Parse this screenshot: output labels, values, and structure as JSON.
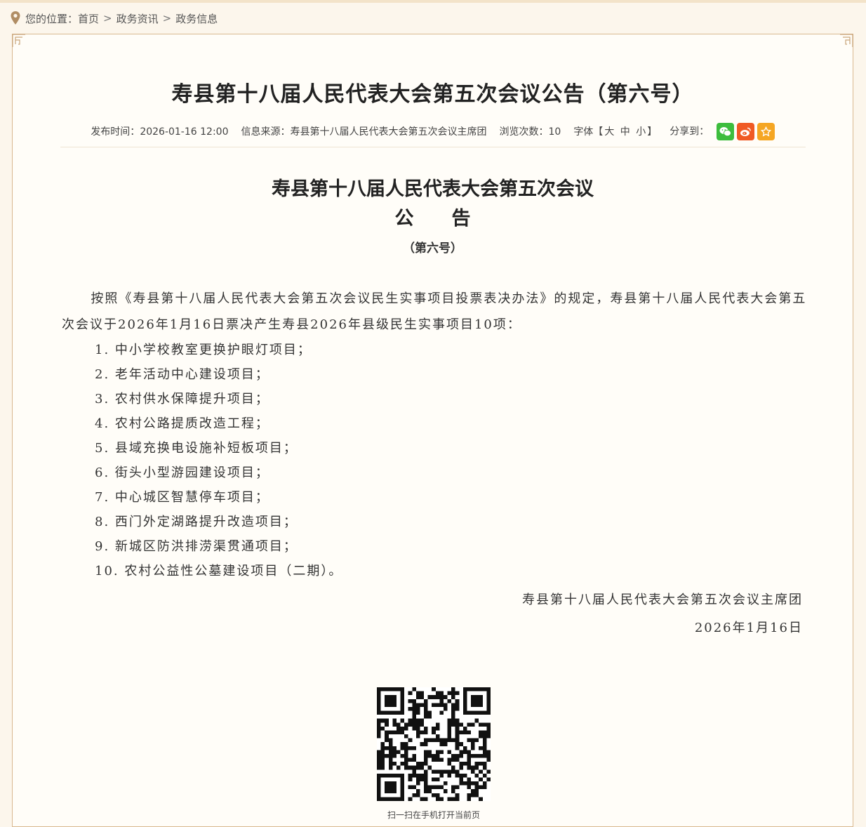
{
  "breadcrumb": {
    "prefix": "您的位置：",
    "items": [
      "首页",
      "政务资讯",
      "政务信息"
    ],
    "separator": ">"
  },
  "article": {
    "title": "寿县第十八届人民代表大会第五次会议公告（第六号）",
    "meta": {
      "publish_label": "发布时间：",
      "publish_time": "2026-01-16 12:00",
      "source_label": "信息来源：",
      "source": "寿县第十八届人民代表大会第五次会议主席团",
      "views_label": "浏览次数：",
      "views": "10",
      "font_label": "字体【",
      "font_large": "大",
      "font_medium": "中",
      "font_small": "小",
      "font_close": "】",
      "share_label": "分享到：",
      "share_icons": [
        "wechat-icon",
        "weibo-icon",
        "favorite-icon"
      ]
    }
  },
  "document": {
    "heading_line1": "寿县第十八届人民代表大会第五次会议",
    "heading_line2": "公　　告",
    "heading_number": "（第六号）",
    "intro": "按照《寿县第十八届人民代表大会第五次会议民生实事项目投票表决办法》的规定，寿县第十八届人民代表大会第五次会议于2026年1月16日票决产生寿县2026年县级民生实事项目10项：",
    "items": [
      "1. 中小学校教室更换护眼灯项目；",
      "2. 老年活动中心建设项目；",
      "3. 农村供水保障提升项目；",
      "4. 农村公路提质改造工程；",
      "5. 县域充换电设施补短板项目；",
      "6. 街头小型游园建设项目；",
      "7. 中心城区智慧停车项目；",
      "8. 西门外定湖路提升改造项目；",
      "9. 新城区防洪排涝渠贯通项目；",
      "10. 农村公益性公墓建设项目（二期）。"
    ],
    "signature": "寿县第十八届人民代表大会第五次会议主席团",
    "date": "2026年1月16日"
  },
  "qr": {
    "caption": "扫一扫在手机打开当前页"
  },
  "colors": {
    "page_bg": "#fcf6ec",
    "frame_border": "#d9b88f",
    "wechat": "#3dbd3d",
    "weibo": "#f05a24",
    "favorite": "#f5a623"
  }
}
